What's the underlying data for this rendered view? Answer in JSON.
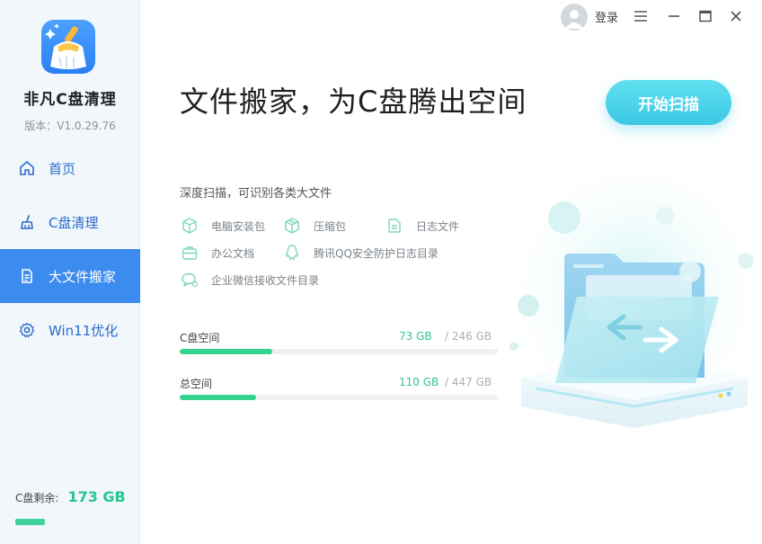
{
  "app": {
    "name": "非凡C盘清理",
    "version": "版本：V1.0.29.76"
  },
  "titlebar": {
    "login_label": "登录"
  },
  "sidebar": {
    "items": [
      {
        "label": "首页",
        "icon": "home-icon",
        "active": false
      },
      {
        "label": "C盘清理",
        "icon": "broom-icon",
        "active": false
      },
      {
        "label": "大文件搬家",
        "icon": "document-icon",
        "active": true
      },
      {
        "label": "Win11优化",
        "icon": "gear-icon",
        "active": false
      }
    ],
    "remaining_label": "C盘剩余:",
    "remaining_value": "173 GB"
  },
  "main": {
    "headline": "文件搬家，为C盘腾出空间",
    "scan_button": "开始扫描",
    "subtitle": "深度扫描，可识别各类大文件",
    "file_types": [
      {
        "label": "电脑安装包",
        "icon": "box-icon"
      },
      {
        "label": "压缩包",
        "icon": "archive-icon"
      },
      {
        "label": "日志文件",
        "icon": "log-file-icon"
      },
      {
        "label": "办公文档",
        "icon": "briefcase-icon"
      },
      {
        "label": "腾讯QQ安全防护日志目录",
        "icon": "qq-icon"
      },
      {
        "label": "企业微信接收文件目录",
        "icon": "chat-icon"
      }
    ],
    "space": [
      {
        "label": "C盘空间",
        "used": "73 GB",
        "total": "/ 246 GB",
        "fraction": 0.29
      },
      {
        "label": "总空间",
        "used": "110 GB",
        "total": "/ 447 GB",
        "fraction": 0.24
      }
    ]
  },
  "colors": {
    "accent_blue": "#3c8cf0",
    "accent_green": "#37d28f",
    "scan_button": "#44cbe8"
  }
}
